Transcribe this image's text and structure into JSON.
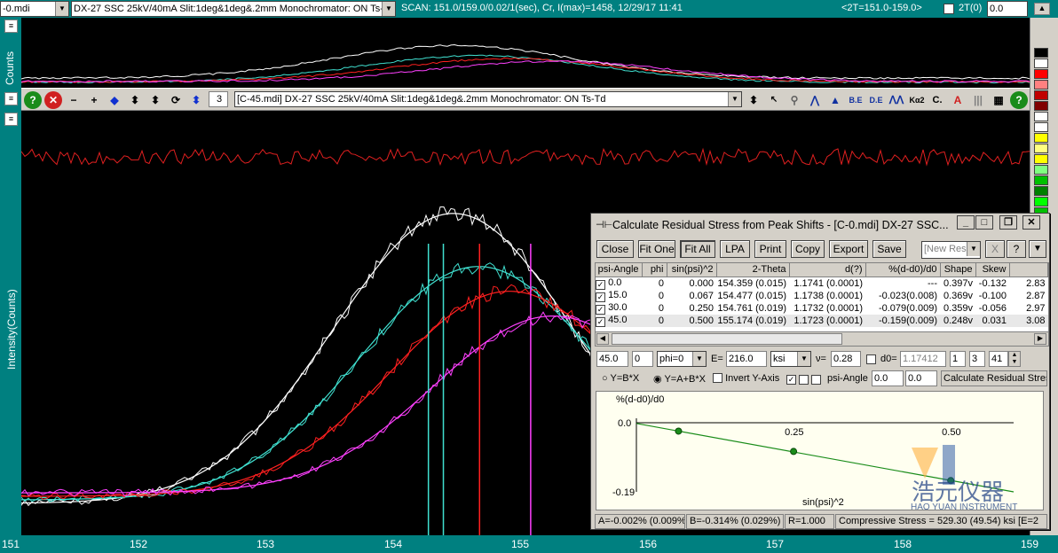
{
  "topbar": {
    "file_combo": "-0.mdi",
    "desc_combo": "DX-27 SSC 25kV/40mA Slit:1deg&1deg&.2mm Monochromator: ON Ts-Td",
    "scan_text": "SCAN: 151.0/159.0/0.02/1(sec), Cr, I(max)=1458, 12/29/17 11:41",
    "range_text": "<2T=151.0-159.0>",
    "twotheta_label": "2T(0)",
    "twotheta_value": "0.0"
  },
  "left_labels": {
    "counts": "Counts",
    "intensity": "Intensity(Counts)"
  },
  "toolbar": {
    "count_value": "3",
    "pattern_combo": "[C-45.mdi] DX-27 SSC 25kV/40mA Slit:1deg&1deg&.2mm Monochromator: ON Ts-Td",
    "icons": [
      "help-icon",
      "close-red-icon",
      "minus-icon",
      "plus-icon",
      "left-right-arrows-icon",
      "up-down-icon",
      "up-down-icon",
      "refresh-icon",
      "up-down-blue-icon"
    ],
    "right_icons": [
      "zoom-cursor-icon",
      "magnify-icon",
      "peak-icon",
      "pattern-icon",
      "be-icon",
      "de-icon",
      "peak-search-icon",
      "ka2-icon",
      "c-icon",
      "at-icon",
      "bars-icon",
      "grid-icon",
      "help-icon"
    ]
  },
  "x_axis": {
    "ticks": [
      "151",
      "152",
      "153",
      "154",
      "155",
      "156",
      "157",
      "158",
      "159"
    ]
  },
  "dialog": {
    "title": "Calculate Residual Stress from Peak Shifts - [C-0.mdi] DX-27 SSC...",
    "buttons": [
      "Close",
      "Fit One",
      "Fit All",
      "LPA",
      "Print",
      "Copy",
      "Export",
      "Save"
    ],
    "new_combo": "[New Resi",
    "x_btn": "X",
    "help_btn": "?",
    "columns": [
      "psi-Angle",
      "phi",
      "sin(psi)^2",
      "2-Theta",
      "d(?)",
      "%(d-d0)/d0",
      "Shape",
      "Skew"
    ],
    "rows": [
      {
        "psi": "0.0",
        "phi": "0",
        "sin": "0.000",
        "two_theta": "154.359 (0.015)",
        "d": "1.1741 (0.0001)",
        "pct": "---",
        "shape": "0.397v",
        "skew": "-0.132",
        "extra": "2.83"
      },
      {
        "psi": "15.0",
        "phi": "0",
        "sin": "0.067",
        "two_theta": "154.477 (0.015)",
        "d": "1.1738 (0.0001)",
        "pct": "-0.023(0.008)",
        "shape": "0.369v",
        "skew": "-0.100",
        "extra": "2.87"
      },
      {
        "psi": "30.0",
        "phi": "0",
        "sin": "0.250",
        "two_theta": "154.761 (0.019)",
        "d": "1.1732 (0.0001)",
        "pct": "-0.079(0.009)",
        "shape": "0.359v",
        "skew": "-0.056",
        "extra": "2.97"
      },
      {
        "psi": "45.0",
        "phi": "0",
        "sin": "0.500",
        "two_theta": "155.174 (0.019)",
        "d": "1.1723 (0.0001)",
        "pct": "-0.159(0.009)",
        "shape": "0.248v",
        "skew": "0.031",
        "extra": "3.08"
      }
    ],
    "inputs": {
      "psi": "45.0",
      "phi": "0",
      "phi_combo": "phi=0",
      "e_label": "E=",
      "e_value": "216.0",
      "unit": "ksi",
      "nu_label": "ν=",
      "nu_value": "0.28",
      "d0_label": "d0=",
      "d0_value": "1.17412",
      "n1": "1",
      "n2": "3",
      "n3": "41"
    },
    "options": {
      "y_bx": "Y=B*X",
      "y_abx": "Y=A+B*X",
      "invert": "Invert Y-Axis",
      "psi_angle": "psi-Angle",
      "v1": "0.0",
      "v2": "0.0",
      "calc": "Calculate Residual Stress"
    },
    "plot": {
      "ylabel": "%(d-d0)/d0",
      "xlabel": "sin(psi)^2",
      "y_ticks": [
        "0.0",
        "-0.19"
      ],
      "x_ticks": [
        "0.25",
        "0.50"
      ]
    },
    "status": {
      "a": "A=-0.002% (0.009%)",
      "b": "B=-0.314% (0.029%)",
      "r": "R=1.000",
      "stress": "Compressive Stress = 529.30 (49.54) ksi [E=2"
    },
    "watermark": {
      "cn": "浩元仪器",
      "en": "HAO YUAN INSTRUMENT"
    }
  },
  "chart_data": {
    "type": "line",
    "x_range": [
      151,
      159
    ],
    "series": [
      {
        "color": "#ffffff",
        "peak_x": 154.55,
        "peak_y": 0.82
      },
      {
        "color": "#40e0d0",
        "peak_x": 154.75,
        "peak_y": 0.66
      },
      {
        "color": "#ff2020",
        "peak_x": 155.0,
        "peak_y": 0.58
      },
      {
        "color": "#ff40ff",
        "peak_x": 155.35,
        "peak_y": 0.5
      }
    ],
    "peak_lines": [
      {
        "x": 154.35,
        "color": "#40e0d0"
      },
      {
        "x": 154.47,
        "color": "#40e0d0"
      },
      {
        "x": 154.76,
        "color": "#ff2020"
      },
      {
        "x": 155.17,
        "color": "#ff40ff"
      }
    ],
    "stress_fit": {
      "points": [
        {
          "x": 0.067,
          "y": -0.023
        },
        {
          "x": 0.25,
          "y": -0.079
        },
        {
          "x": 0.5,
          "y": -0.159
        }
      ],
      "line": [
        {
          "x": 0,
          "y": -0.002
        },
        {
          "x": 0.6,
          "y": -0.19
        }
      ],
      "ylim": [
        -0.19,
        0.0
      ],
      "xlim": [
        0,
        0.6
      ]
    }
  },
  "palette": [
    "#000000",
    "#ffffff",
    "#ff0000",
    "#ff8080",
    "#c00000",
    "#800000",
    "#ffffff",
    "#ffffff",
    "#ffff00",
    "#ffff80",
    "#ffff00",
    "#80ff80",
    "#00c000",
    "#008000",
    "#00ff00",
    "#00c000",
    "#c0ffc0"
  ]
}
